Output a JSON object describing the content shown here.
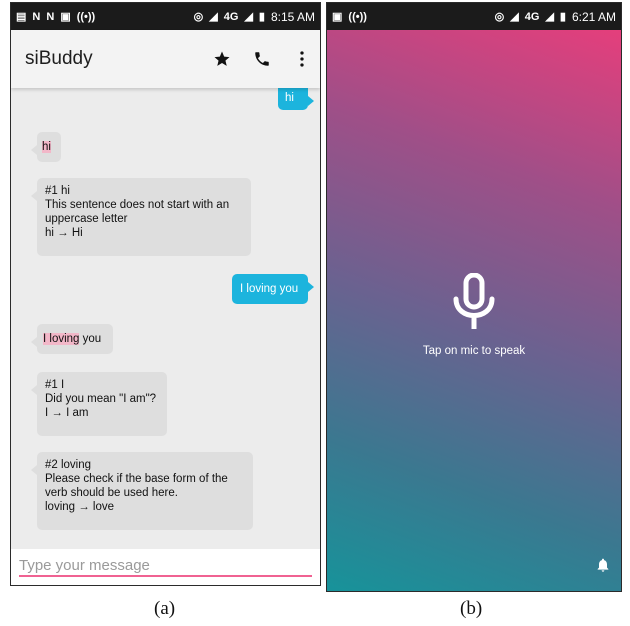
{
  "panel_a": {
    "status_time": "8:15 AM",
    "status_network": "4G",
    "app_title": "siBuddy",
    "icons": {
      "favorite": "star-icon",
      "call": "phone-icon",
      "menu": "more-vert-icon"
    },
    "messages": {
      "out_hi": "hi",
      "in_hi": "hi",
      "correction_1": {
        "title": "#1 hi",
        "text": "This sentence does not start with an uppercase letter",
        "change": "hi → Hi"
      },
      "out_loving": "I loving you",
      "in_loving": {
        "highlight": "I loving",
        "rest": " you"
      },
      "correction_2": {
        "title": "#1 I",
        "text": "Did you mean \"I am\"?",
        "change": "I → I am"
      },
      "correction_3": {
        "title": "#2 loving",
        "text": "Please check if the base form of the verb should be used here.",
        "change": "loving → love"
      }
    },
    "input_placeholder": "Type your message",
    "caption": "(a)"
  },
  "panel_b": {
    "status_time": "6:21 AM",
    "status_network": "4G",
    "hint": "Tap on mic to speak",
    "icons": {
      "mic": "mic-icon",
      "notify": "bell-icon"
    },
    "caption": "(b)"
  },
  "colors": {
    "outgoing_bubble": "#1cb4dd",
    "incoming_bubble": "#dedede",
    "highlight": "#f2b7c8",
    "input_underline": "#f06292",
    "gradient_top": "#ef3c7a",
    "gradient_bottom": "#17939a"
  }
}
